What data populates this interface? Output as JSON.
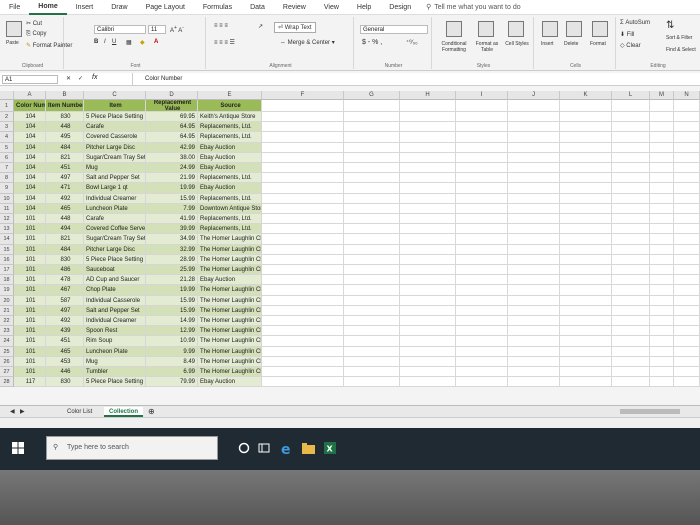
{
  "menu": [
    "File",
    "Home",
    "Insert",
    "Draw",
    "Page Layout",
    "Formulas",
    "Data",
    "Review",
    "View",
    "Help",
    "Design"
  ],
  "tell_me": "Tell me what you want to do",
  "ribbon": {
    "cut": "Cut",
    "copy": "Copy",
    "format_painter": "Format Painter",
    "paste": "Paste",
    "clipboard": "Clipboard",
    "font_name": "Calibri",
    "font_size": "11",
    "font_group": "Font",
    "wrap_text": "Wrap Text",
    "merge_center": "Merge & Center",
    "alignment_group": "Alignment",
    "number_format": "General",
    "number_symbols": "$ - % ,",
    "number_group": "Number",
    "conditional": "Conditional Formatting",
    "format_as_table": "Format as Table",
    "cell_styles": "Cell Styles",
    "styles_group": "Styles",
    "insert": "Insert",
    "delete": "Delete",
    "format": "Format",
    "cells_group": "Cells",
    "autosum": "AutoSum",
    "fill": "Fill",
    "clear": "Clear",
    "sort_filter": "Sort & Filter",
    "find_select": "Find & Select",
    "editing_group": "Editing"
  },
  "formula_bar": {
    "name_box": "A1",
    "fx": "fx",
    "content": "Color Number"
  },
  "columns": [
    "A",
    "B",
    "C",
    "D",
    "E",
    "F",
    "G",
    "H",
    "I",
    "J",
    "K",
    "L",
    "M",
    "N",
    "O"
  ],
  "headers": {
    "a": "Color Number",
    "b": "Item Number",
    "c": "Item",
    "d_top": "Replacement",
    "d": "Value",
    "e": "Source"
  },
  "rows": [
    [
      "1",
      "104",
      "830",
      "5 Piece Place Setting",
      "69.95",
      "Keith's Antique Store"
    ],
    [
      "2",
      "104",
      "448",
      "Carafe",
      "64.95",
      "Replacements, Ltd."
    ],
    [
      "3",
      "104",
      "495",
      "Covered Casserole",
      "64.95",
      "Replacements, Ltd."
    ],
    [
      "4",
      "104",
      "484",
      "Pitcher Large Disc",
      "42.99",
      "Ebay Auction"
    ],
    [
      "5",
      "104",
      "821",
      "Sugar/Cream Tray Set",
      "38.00",
      "Ebay Auction"
    ],
    [
      "6",
      "104",
      "451",
      "Mug",
      "24.99",
      "Ebay Auction"
    ],
    [
      "7",
      "104",
      "497",
      "Salt and Pepper Set",
      "21.99",
      "Replacements, Ltd."
    ],
    [
      "8",
      "104",
      "471",
      "Bowl Large 1 qt",
      "19.99",
      "Ebay Auction"
    ],
    [
      "9",
      "104",
      "492",
      "Individual Creamer",
      "15.99",
      "Replacements, Ltd."
    ],
    [
      "10",
      "104",
      "465",
      "Luncheon Plate",
      "7.99",
      "Downtown Antique Store"
    ],
    [
      "11",
      "101",
      "448",
      "Carafe",
      "41.99",
      "Replacements, Ltd."
    ],
    [
      "12",
      "101",
      "494",
      "Covered Coffee Server",
      "39.99",
      "Replacements, Ltd."
    ],
    [
      "13",
      "101",
      "821",
      "Sugar/Cream Tray Set",
      "34.99",
      "The Homer Laughlin China Co."
    ],
    [
      "14",
      "101",
      "484",
      "Pitcher Large Disc",
      "32.99",
      "The Homer Laughlin China Co."
    ],
    [
      "15",
      "101",
      "830",
      "5 Piece Place Setting",
      "28.99",
      "The Homer Laughlin China Co."
    ],
    [
      "16",
      "101",
      "486",
      "Sauceboat",
      "25.99",
      "The Homer Laughlin China Co."
    ],
    [
      "17",
      "101",
      "478",
      "AD Cup and Saucer",
      "21.28",
      "Ebay Auction"
    ],
    [
      "18",
      "101",
      "467",
      "Chop Plate",
      "19.99",
      "The Homer Laughlin China Co."
    ],
    [
      "19",
      "101",
      "587",
      "Individual Casserole",
      "15.99",
      "The Homer Laughlin China Co."
    ],
    [
      "20",
      "101",
      "497",
      "Salt and Pepper Set",
      "15.99",
      "The Homer Laughlin China Co."
    ],
    [
      "21",
      "101",
      "492",
      "Individual Creamer",
      "14.99",
      "The Homer Laughlin China Co."
    ],
    [
      "22",
      "101",
      "439",
      "Spoon Rest",
      "12.99",
      "The Homer Laughlin China Co."
    ],
    [
      "23",
      "101",
      "451",
      "Rim Soup",
      "10.99",
      "The Homer Laughlin China Co."
    ],
    [
      "24",
      "101",
      "465",
      "Luncheon Plate",
      "9.99",
      "The Homer Laughlin China Co."
    ],
    [
      "25",
      "101",
      "453",
      "Mug",
      "8.49",
      "The Homer Laughlin China Co."
    ],
    [
      "26",
      "101",
      "446",
      "Tumbler",
      "6.99",
      "The Homer Laughlin China Co."
    ],
    [
      "27",
      "117",
      "830",
      "5 Piece Place Setting",
      "79.99",
      "Ebay Auction"
    ]
  ],
  "sheet_tabs": [
    "Color List",
    "Collection"
  ],
  "taskbar": {
    "search_placeholder": "Type here to search"
  }
}
